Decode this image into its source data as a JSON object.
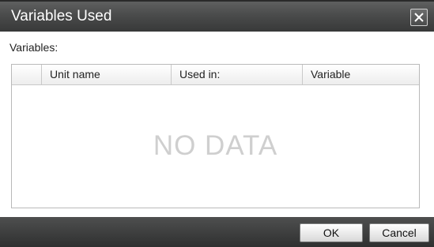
{
  "dialog": {
    "title": "Variables Used",
    "close_icon": "close-icon"
  },
  "variables_label": "Variables:",
  "table": {
    "columns": [
      "",
      "Unit name",
      "Used in:",
      "Variable"
    ],
    "rows": [],
    "empty_text": "NO DATA"
  },
  "footer": {
    "ok_label": "OK",
    "cancel_label": "Cancel"
  }
}
